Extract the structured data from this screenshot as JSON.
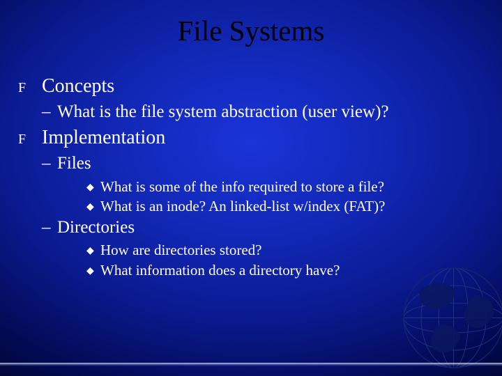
{
  "title": "File Systems",
  "bullets": {
    "l1_0": "Concepts",
    "l2_0": "What is the file system abstraction (user view)?",
    "l1_1": "Implementation",
    "l2_1": "Files",
    "l3_0": "What is some of the info required to store a file?",
    "l3_1": "What is an inode? An linked-list w/index (FAT)?",
    "l2_2": "Directories",
    "l3_2": "How are directories stored?",
    "l3_3": "What information does a directory have?"
  },
  "glyphs": {
    "lvl1": "F",
    "lvl2": "–",
    "lvl3": "◆"
  }
}
